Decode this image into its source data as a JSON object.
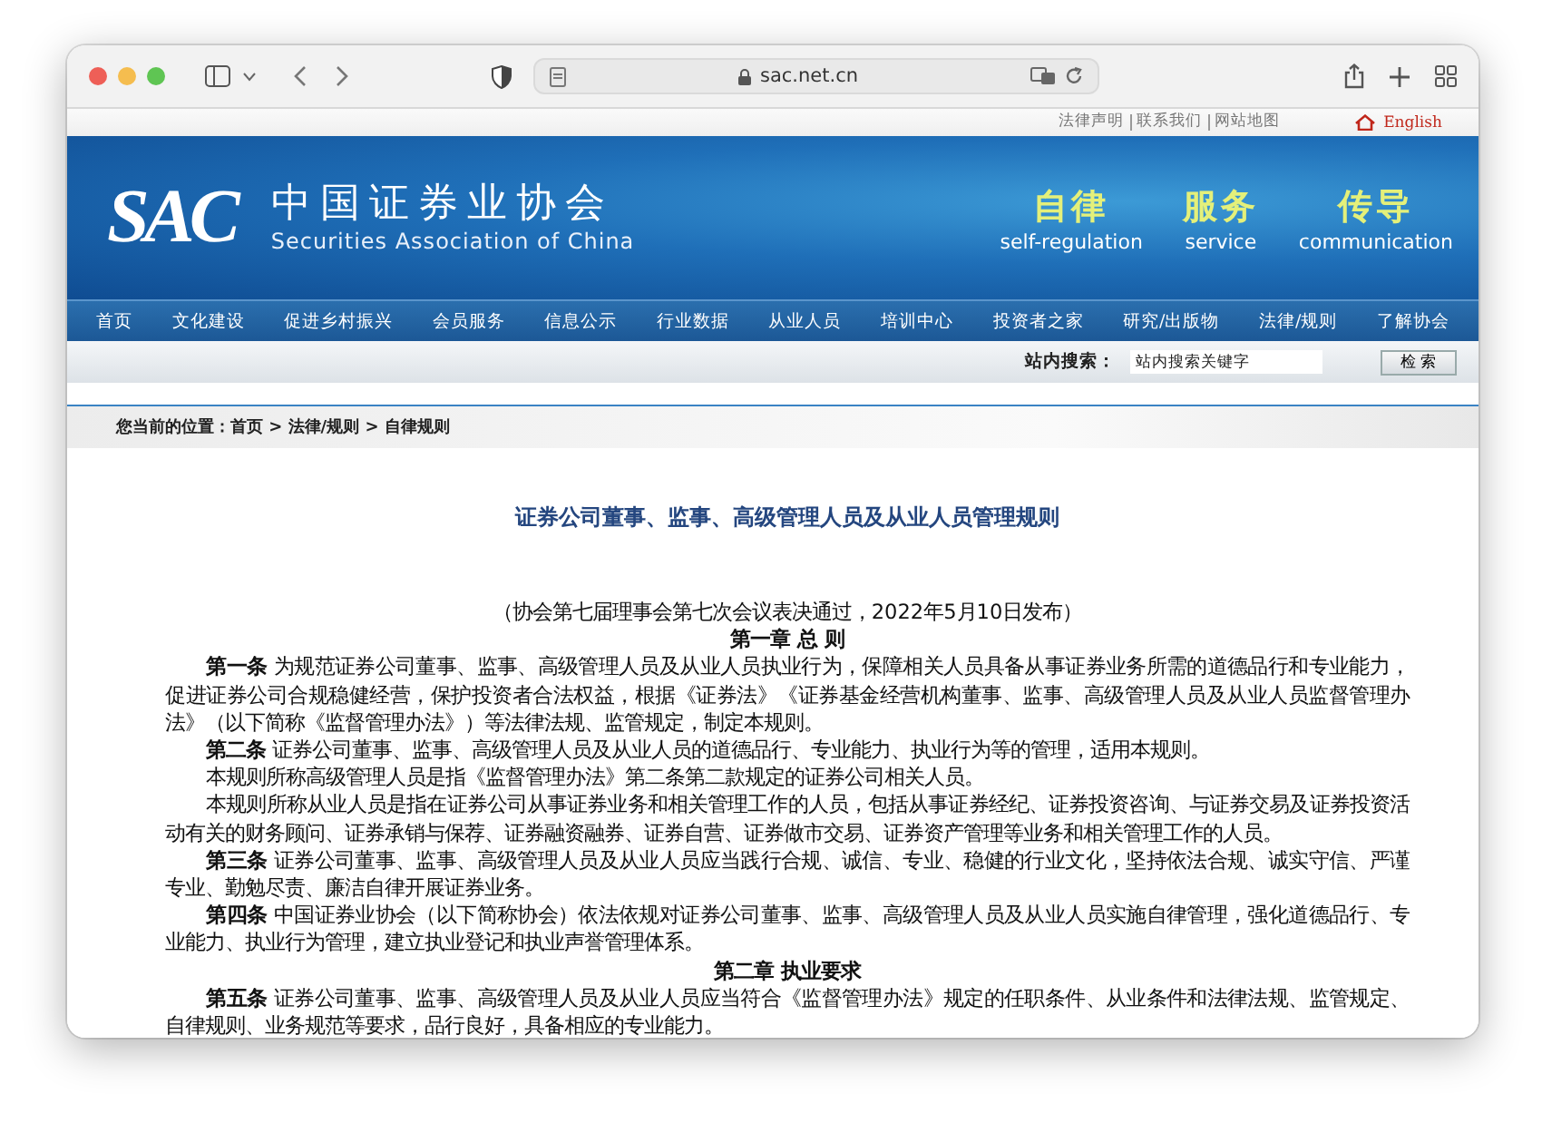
{
  "browser": {
    "url": "sac.net.cn"
  },
  "top_links": [
    "法律声明",
    "联系我们",
    "网站地图"
  ],
  "language_link": "English",
  "banner": {
    "logo": "SAC",
    "name_zh": "中国证券业协会",
    "name_en": "Securities Association of China",
    "slogans": [
      {
        "zh": "自律",
        "en": "self-regulation"
      },
      {
        "zh": "服务",
        "en": "service"
      },
      {
        "zh": "传导",
        "en": "communication"
      }
    ]
  },
  "nav": [
    "首页",
    "文化建设",
    "促进乡村振兴",
    "会员服务",
    "信息公示",
    "行业数据",
    "从业人员",
    "培训中心",
    "投资者之家",
    "研究/出版物",
    "法律/规则",
    "了解协会"
  ],
  "search": {
    "label": "站内搜索：",
    "value": "站内搜索关键字",
    "button": "检 索"
  },
  "breadcrumb": "您当前的位置：首页 > 法律/规则 > 自律规则",
  "article": {
    "title": "证券公司董事、监事、高级管理人员及从业人员管理规则",
    "blocks": [
      {
        "kind": "subtitle",
        "text": "（协会第七届理事会第七次会议表决通过，2022年5月10日发布）"
      },
      {
        "kind": "chapter",
        "text": "第一章 总 则"
      },
      {
        "kind": "paragraph",
        "text": "**第一条** 为规范证券公司董事、监事、高级管理人员及从业人员执业行为，保障相关人员具备从事证券业务所需的道德品行和专业能力，促进证券公司合规稳健经营，保护投资者合法权益，根据《证券法》《证券基金经营机构董事、监事、高级管理人员及从业人员监督管理办法》（以下简称《监督管理办法》）等法律法规、监管规定，制定本规则。"
      },
      {
        "kind": "paragraph",
        "text": "**第二条** 证券公司董事、监事、高级管理人员及从业人员的道德品行、专业能力、执业行为等的管理，适用本规则。"
      },
      {
        "kind": "paragraph",
        "text": "本规则所称高级管理人员是指《监督管理办法》第二条第二款规定的证券公司相关人员。"
      },
      {
        "kind": "paragraph",
        "text": "本规则所称从业人员是指在证券公司从事证券业务和相关管理工作的人员，包括从事证券经纪、证券投资咨询、与证券交易及证券投资活动有关的财务顾问、证券承销与保荐、证券融资融券、证券自营、证券做市交易、证券资产管理等业务和相关管理工作的人员。"
      },
      {
        "kind": "paragraph",
        "text": "**第三条** 证券公司董事、监事、高级管理人员及从业人员应当践行合规、诚信、专业、稳健的行业文化，坚持依法合规、诚实守信、严谨专业、勤勉尽责、廉洁自律开展证券业务。"
      },
      {
        "kind": "paragraph",
        "text": "**第四条** 中国证券业协会（以下简称协会）依法依规对证券公司董事、监事、高级管理人员及从业人员实施自律管理，强化道德品行、专业能力、执业行为管理，建立执业登记和执业声誉管理体系。"
      },
      {
        "kind": "chapter",
        "text": "第二章 执业要求"
      },
      {
        "kind": "paragraph",
        "text": "**第五条** 证券公司董事、监事、高级管理人员及从业人员应当符合《监督管理办法》规定的任职条件、从业条件和法律法规、监管规定、自律规则、业务规范等要求，品行良好，具备相应的专业能力。"
      }
    ]
  }
}
